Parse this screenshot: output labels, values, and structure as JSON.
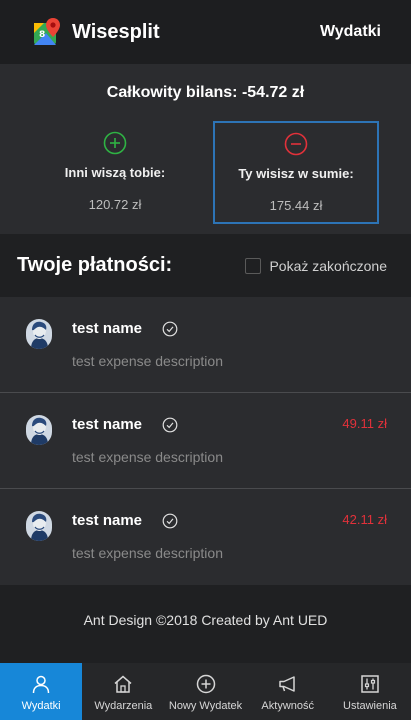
{
  "header": {
    "brand": "Wisesplit",
    "link": "Wydatki"
  },
  "balance": {
    "title": "Całkowity bilans: -54.72 zł",
    "others_owe_label": "Inni wiszą tobie:",
    "others_owe_value": "120.72 zł",
    "you_owe_label": "Ty wisisz w sumie:",
    "you_owe_value": "175.44 zł"
  },
  "payments": {
    "title": "Twoje płatności:",
    "show_completed_label": "Pokaż zakończone",
    "items": [
      {
        "name": "test name",
        "description": "test expense description",
        "amount": ""
      },
      {
        "name": "test name",
        "description": "test expense description",
        "amount": "49.11 zł"
      },
      {
        "name": "test name",
        "description": "test expense description",
        "amount": "42.11 zł"
      }
    ]
  },
  "footer": {
    "text": "Ant Design ©2018 Created by Ant UED"
  },
  "tabs": [
    {
      "label": "Wydatki",
      "icon": "user-icon"
    },
    {
      "label": "Wydarzenia",
      "icon": "home-icon"
    },
    {
      "label": "Nowy Wydatek",
      "icon": "plus-circle-icon"
    },
    {
      "label": "Aktywność",
      "icon": "megaphone-icon"
    },
    {
      "label": "Ustawienia",
      "icon": "sliders-icon"
    }
  ],
  "colors": {
    "accent": "#1787d8",
    "positive": "#2fb344",
    "negative": "#e1313a",
    "highlight_border": "#2d74b6"
  }
}
